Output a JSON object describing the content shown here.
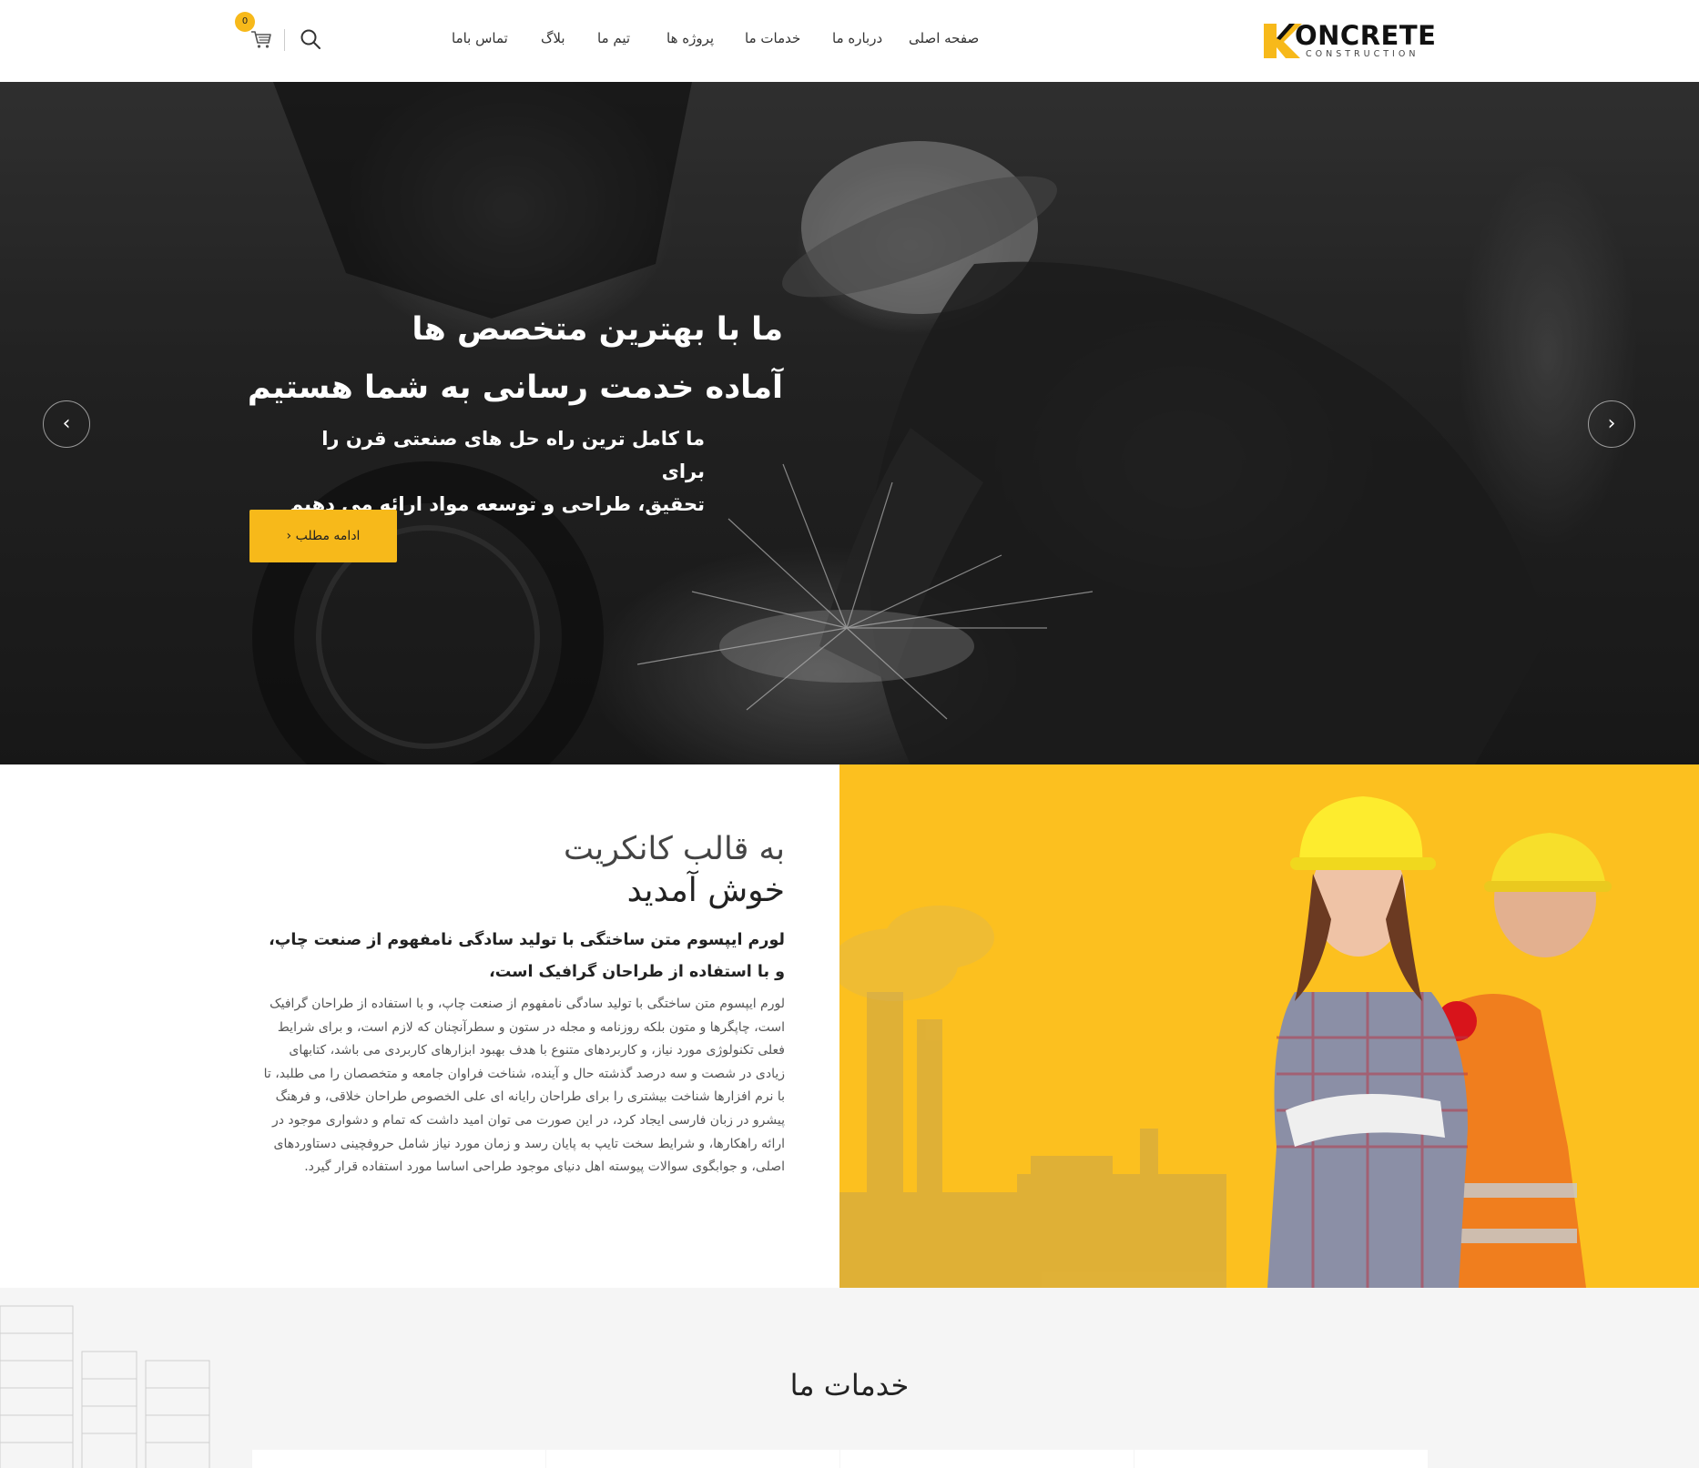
{
  "brand": {
    "name": "ONCRETE",
    "sub": "CONSTRUCTION",
    "accent": "#f7b91a"
  },
  "nav": {
    "items": [
      {
        "label": "صفحه اصلی"
      },
      {
        "label": "درباره ما"
      },
      {
        "label": "خدمات ما"
      },
      {
        "label": "پروژه ها"
      },
      {
        "label": "تیم ما"
      },
      {
        "label": "بلاگ"
      },
      {
        "label": "تماس باما"
      }
    ],
    "cart_count": "0",
    "search_icon": "search-icon",
    "cart_icon": "cart-icon"
  },
  "hero": {
    "title_line1": "ما با بهترین متخصص ها",
    "title_line2": "آماده خدمت رسانی به شما هستیم",
    "subtitle_line1": "ما کامل ترین راه حل های صنعتی قرن را برای",
    "subtitle_line2": "تحقیق، طراحی و توسعه مواد ارائه می دهیم",
    "button_label": "ادامه مطلب",
    "prev_icon": "chevron-left-icon",
    "next_icon": "chevron-right-icon"
  },
  "welcome": {
    "title_line1": "به قالب کانکریت",
    "title_line2": "خوش آمدید",
    "lead": "لورم ایپسوم متن ساختگی با تولید سادگی نامفهوم از صنعت چاپ، و با استفاده از طراحان گرافیک است،",
    "body": "لورم ایپسوم متن ساختگی با تولید سادگی نامفهوم از صنعت چاپ، و با استفاده از طراحان گرافیک است، چاپگرها و متون بلکه روزنامه و مجله در ستون و سطرآنچنان که لازم است، و برای شرایط فعلی تکنولوژی مورد نیاز، و کاربردهای متنوع با هدف بهبود ابزارهای کاربردی می باشد، کتابهای زیادی در شصت و سه درصد گذشته حال و آینده، شناخت فراوان جامعه و متخصصان را می طلبد، تا با نرم افزارها شناخت بیشتری را برای طراحان رایانه ای علی الخصوص طراحان خلاقی، و فرهنگ پیشرو در زبان فارسی ایجاد کرد، در این صورت می توان امید داشت که تمام و دشواری موجود در ارائه راهکارها، و شرایط سخت تایپ به پایان رسد و زمان مورد نیاز شامل حروفچینی دستاوردهای اصلی، و جوابگوی سوالات پیوسته اهل دنیای موجود طراحی اساسا مورد استفاده قرار گیرد."
  },
  "services": {
    "title": "خدمات ما"
  }
}
